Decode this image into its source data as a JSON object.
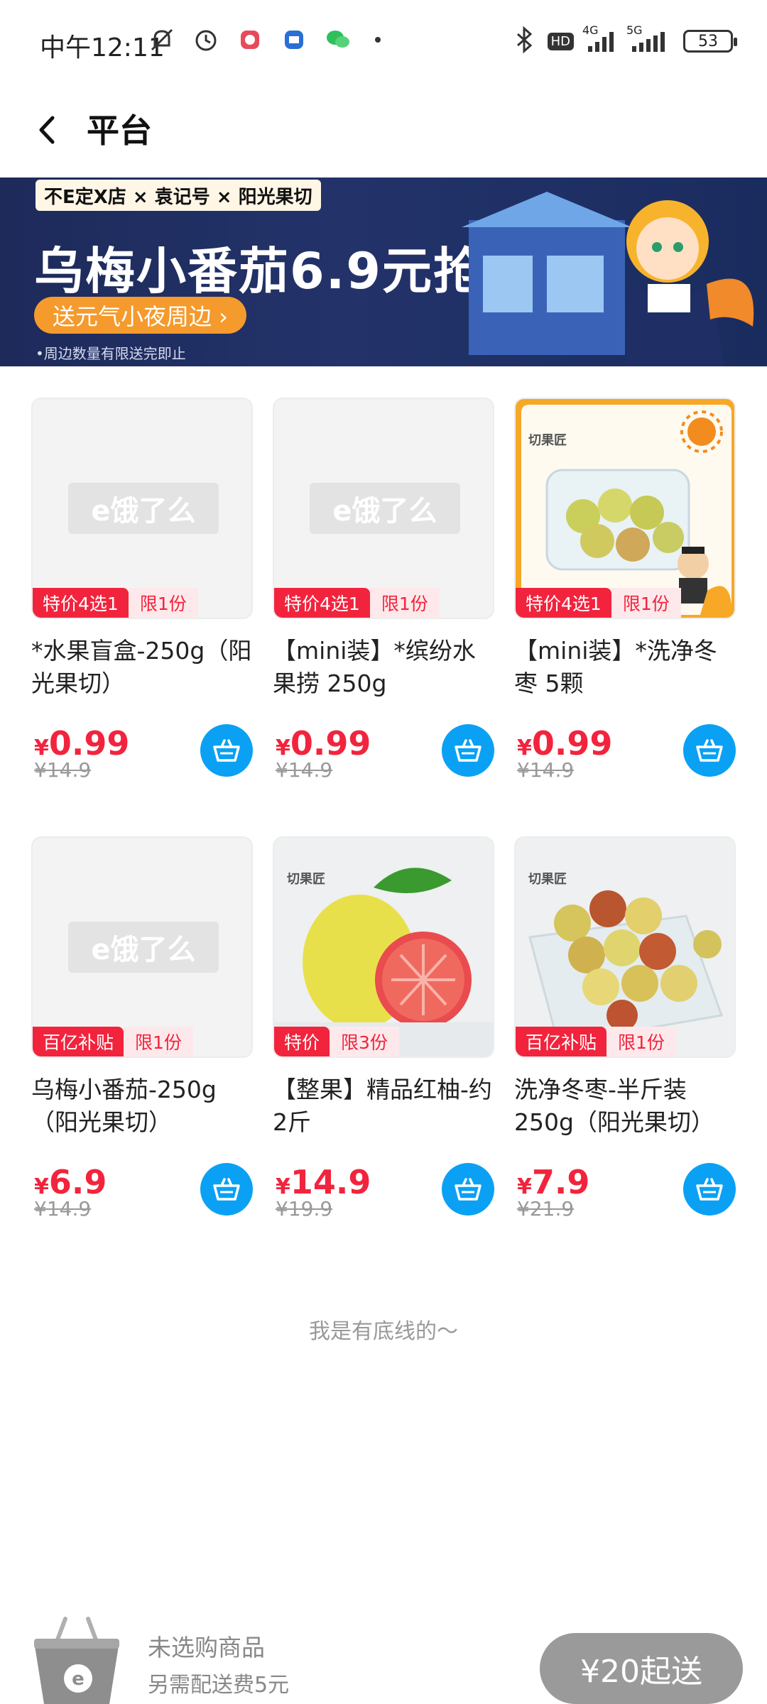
{
  "status_bar": {
    "time": "中午12:11",
    "battery": "53",
    "net1": "4G",
    "net2": "5G",
    "hd": "HD"
  },
  "nav": {
    "title": "平台"
  },
  "banner": {
    "brands": "不E定X店 × 袁记号 × 阳光果切",
    "title": "乌梅小番茄6.9元抢",
    "pill": "送元气小夜周边 ›",
    "note": "•周边数量有限送完即止"
  },
  "placeholder_logo_text": "e饿了么",
  "products": [
    {
      "tag_main": "特价4选1",
      "tag_sub": "限1份",
      "name": "*水果盲盒-250g（阳光果切）",
      "yen": "¥",
      "price": "0.99",
      "orig": "¥14.9",
      "image": "placeholder"
    },
    {
      "tag_main": "特价4选1",
      "tag_sub": "限1份",
      "name": "【mini装】*缤纷水果捞 250g",
      "yen": "¥",
      "price": "0.99",
      "orig": "¥14.9",
      "image": "placeholder"
    },
    {
      "tag_main": "特价4选1",
      "tag_sub": "限1份",
      "name": "【mini装】*洗净冬枣 5颗",
      "yen": "¥",
      "price": "0.99",
      "orig": "¥14.9",
      "image": "jujube-box"
    },
    {
      "tag_main": "百亿补贴",
      "tag_sub": "限1份",
      "name": "乌梅小番茄-250g（阳光果切）",
      "yen": "¥",
      "price": "6.9",
      "orig": "¥14.9",
      "image": "placeholder"
    },
    {
      "tag_main": "特价",
      "tag_sub": "限3份",
      "name": "【整果】精品红柚-约2斤",
      "yen": "¥",
      "price": "14.9",
      "orig": "¥19.9",
      "image": "pomelo"
    },
    {
      "tag_main": "百亿补贴",
      "tag_sub": "限1份",
      "name": "洗净冬枣-半斤装 250g（阳光果切）",
      "yen": "¥",
      "price": "7.9",
      "orig": "¥21.9",
      "image": "jujube"
    }
  ],
  "brand_mark": "切果匠",
  "footer": "我是有底线的～",
  "bottom_bar": {
    "title": "未选购商品",
    "subtitle": "另需配送费5元",
    "button": "¥20起送"
  },
  "colors": {
    "accent_red": "#f2243d",
    "cart_blue": "#0aa1f4",
    "button_gray": "#9a9a9a"
  }
}
